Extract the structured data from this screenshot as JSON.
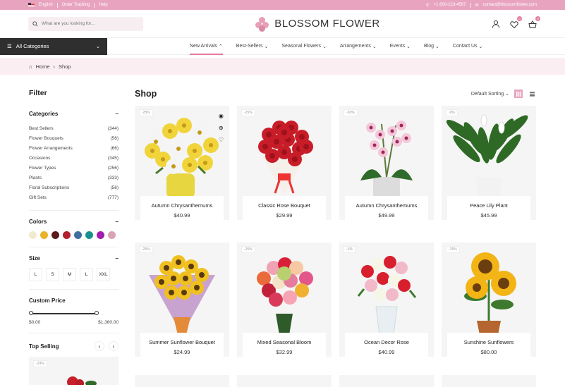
{
  "topbar": {
    "language": "English",
    "order_tracking": "Order Tracking",
    "help": "Help",
    "phone": "+1 800-123-4567",
    "email": "contact@blossomflower.com"
  },
  "header": {
    "search_placeholder": "What are you looking for...",
    "brand": "BLOSSOM FLOWER",
    "wishlist_count": "0",
    "cart_count": "0"
  },
  "nav": {
    "categories_button": "All Categories",
    "items": [
      "New Arrivals",
      "Best-Sellers",
      "Seasonal Flowers",
      "Arrangements",
      "Events",
      "Blog",
      "Contact Us"
    ]
  },
  "breadcrumb": {
    "home": "Home",
    "current": "Shop"
  },
  "sidebar": {
    "title": "Filter",
    "categories_title": "Categories",
    "categories": [
      {
        "label": "Best Sellers",
        "count": "(344)"
      },
      {
        "label": "Flower Bouquets",
        "count": "(56)"
      },
      {
        "label": "Flower Arrangements",
        "count": "(66)"
      },
      {
        "label": "Occasions",
        "count": "(345)"
      },
      {
        "label": "Flower Types",
        "count": "(256)"
      },
      {
        "label": "Plants",
        "count": "(333)"
      },
      {
        "label": "Floral Subscriptions",
        "count": "(56)"
      },
      {
        "label": "Gift Sets",
        "count": "(777)"
      }
    ],
    "colors_title": "Colors",
    "colors": [
      "#f2ead0",
      "#e9b42a",
      "#5c1a1a",
      "#b3202f",
      "#3f6fa0",
      "#17918f",
      "#a21caf",
      "#d9a3b5"
    ],
    "size_title": "Size",
    "sizes": [
      "L",
      "S",
      "M",
      "L",
      "XXL"
    ],
    "price_title": "Custom Price",
    "price_min": "$0.00",
    "price_max": "$1,360.00",
    "top_selling_title": "Top Selling",
    "top_selling_discount": "-29%"
  },
  "shop": {
    "title": "Shop",
    "sort_label": "Default Sorting",
    "products": [
      {
        "name": "Autumn Chrysanthemums",
        "price": "$40.99",
        "discount": "-25%"
      },
      {
        "name": "Classic Rose Bouquet",
        "price": "$29.99",
        "discount": "-25%"
      },
      {
        "name": "Autumn Chrysanthemums",
        "price": "$49.99",
        "discount": "-50%"
      },
      {
        "name": "Peace Lily Plant",
        "price": "$45.99",
        "discount": "-9%"
      },
      {
        "name": "Summer Sunflower Bouquet",
        "price": "$24.99",
        "discount": "-25%"
      },
      {
        "name": "Mixed Seasonal Bloom",
        "price": "$32.99",
        "discount": "-25%"
      },
      {
        "name": "Ocean Decor Rose",
        "price": "$40.99",
        "discount": "-3%"
      },
      {
        "name": "Sunshine Sunflowers",
        "price": "$80.00",
        "discount": "-25%"
      }
    ]
  }
}
